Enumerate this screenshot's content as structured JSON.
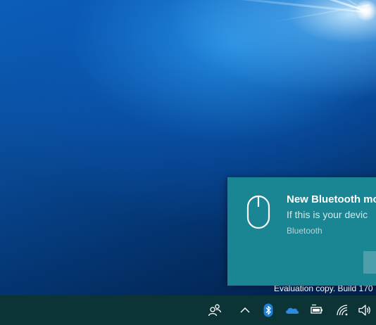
{
  "notification": {
    "title": "New Bluetooth mo",
    "body": "If this is your devic",
    "source": "Bluetooth",
    "icon": "mouse-icon",
    "background_color": "#1a8593"
  },
  "watermark": {
    "text": "Evaluation copy. Build 170"
  },
  "taskbar": {
    "background_color": "#0c3436",
    "tray_icons": [
      "people-icon",
      "chevron-up-icon",
      "bluetooth-icon",
      "onedrive-icon",
      "battery-icon",
      "wifi-icon",
      "volume-icon"
    ]
  }
}
